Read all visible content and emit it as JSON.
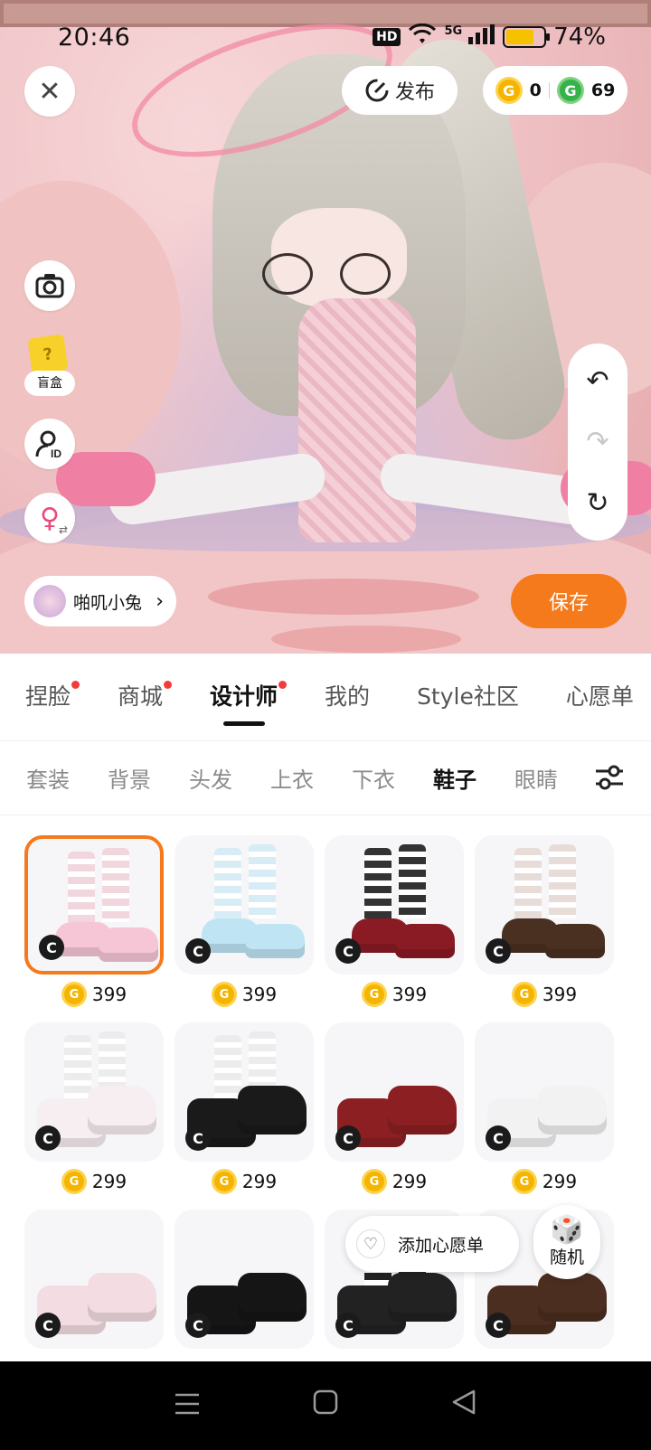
{
  "status_bar": {
    "time": "20:46",
    "hd": "HD",
    "network": "5G",
    "battery": "74%",
    "battery_level": 0.74
  },
  "top": {
    "publish_label": "发布",
    "gold_coins": "0",
    "green_coins": "69",
    "gold_coin_glyph": "G",
    "green_coin_glyph": "G"
  },
  "left_tools": {
    "blind_box_label": "盲盒",
    "blind_box_glyph": "?"
  },
  "profile": {
    "name": "啪叽小兔"
  },
  "save_label": "保存",
  "main_tabs": [
    {
      "label": "捏脸",
      "dot": true
    },
    {
      "label": "商城",
      "dot": true
    },
    {
      "label": "设计师",
      "dot": true,
      "active": true
    },
    {
      "label": "我的",
      "dot": false
    },
    {
      "label": "Style社区",
      "dot": false
    },
    {
      "label": "心愿单",
      "dot": false
    }
  ],
  "sub_tabs": [
    {
      "label": "套装"
    },
    {
      "label": "背景"
    },
    {
      "label": "头发"
    },
    {
      "label": "上衣"
    },
    {
      "label": "下衣"
    },
    {
      "label": "鞋子",
      "active": true
    },
    {
      "label": "眼睛"
    }
  ],
  "items": [
    {
      "price": "399",
      "badge": "C",
      "selected": true,
      "color": "#f6c6d6",
      "sock": "#f2d6de"
    },
    {
      "price": "399",
      "badge": "C",
      "color": "#bfe4f4",
      "sock": "#d7ecf4"
    },
    {
      "price": "399",
      "badge": "C",
      "color": "#8a1a24",
      "sock": "#333"
    },
    {
      "price": "399",
      "badge": "C",
      "color": "#4a3020",
      "sock": "#e8dcd8"
    },
    {
      "price": "299",
      "badge": "C",
      "color": "#f7eef2",
      "sock": "#ececec"
    },
    {
      "price": "299",
      "badge": "C",
      "color": "#1a1a1a",
      "sock": "#ececec"
    },
    {
      "price": "299",
      "badge": "C",
      "color": "#8b1f22",
      "sock": ""
    },
    {
      "price": "299",
      "badge": "C",
      "color": "#f2f2f2",
      "sock": ""
    },
    {
      "price": "",
      "badge": "C",
      "color": "#f3dde3",
      "sock": ""
    },
    {
      "price": "",
      "badge": "C",
      "color": "#151515",
      "sock": ""
    },
    {
      "price": "",
      "badge": "C",
      "color": "#222",
      "sock": "#222"
    },
    {
      "price": "",
      "badge": "C",
      "color": "#4b2e1f",
      "sock": ""
    }
  ],
  "floating": {
    "wishlist_label": "添加心愿单",
    "random_label": "随机"
  }
}
